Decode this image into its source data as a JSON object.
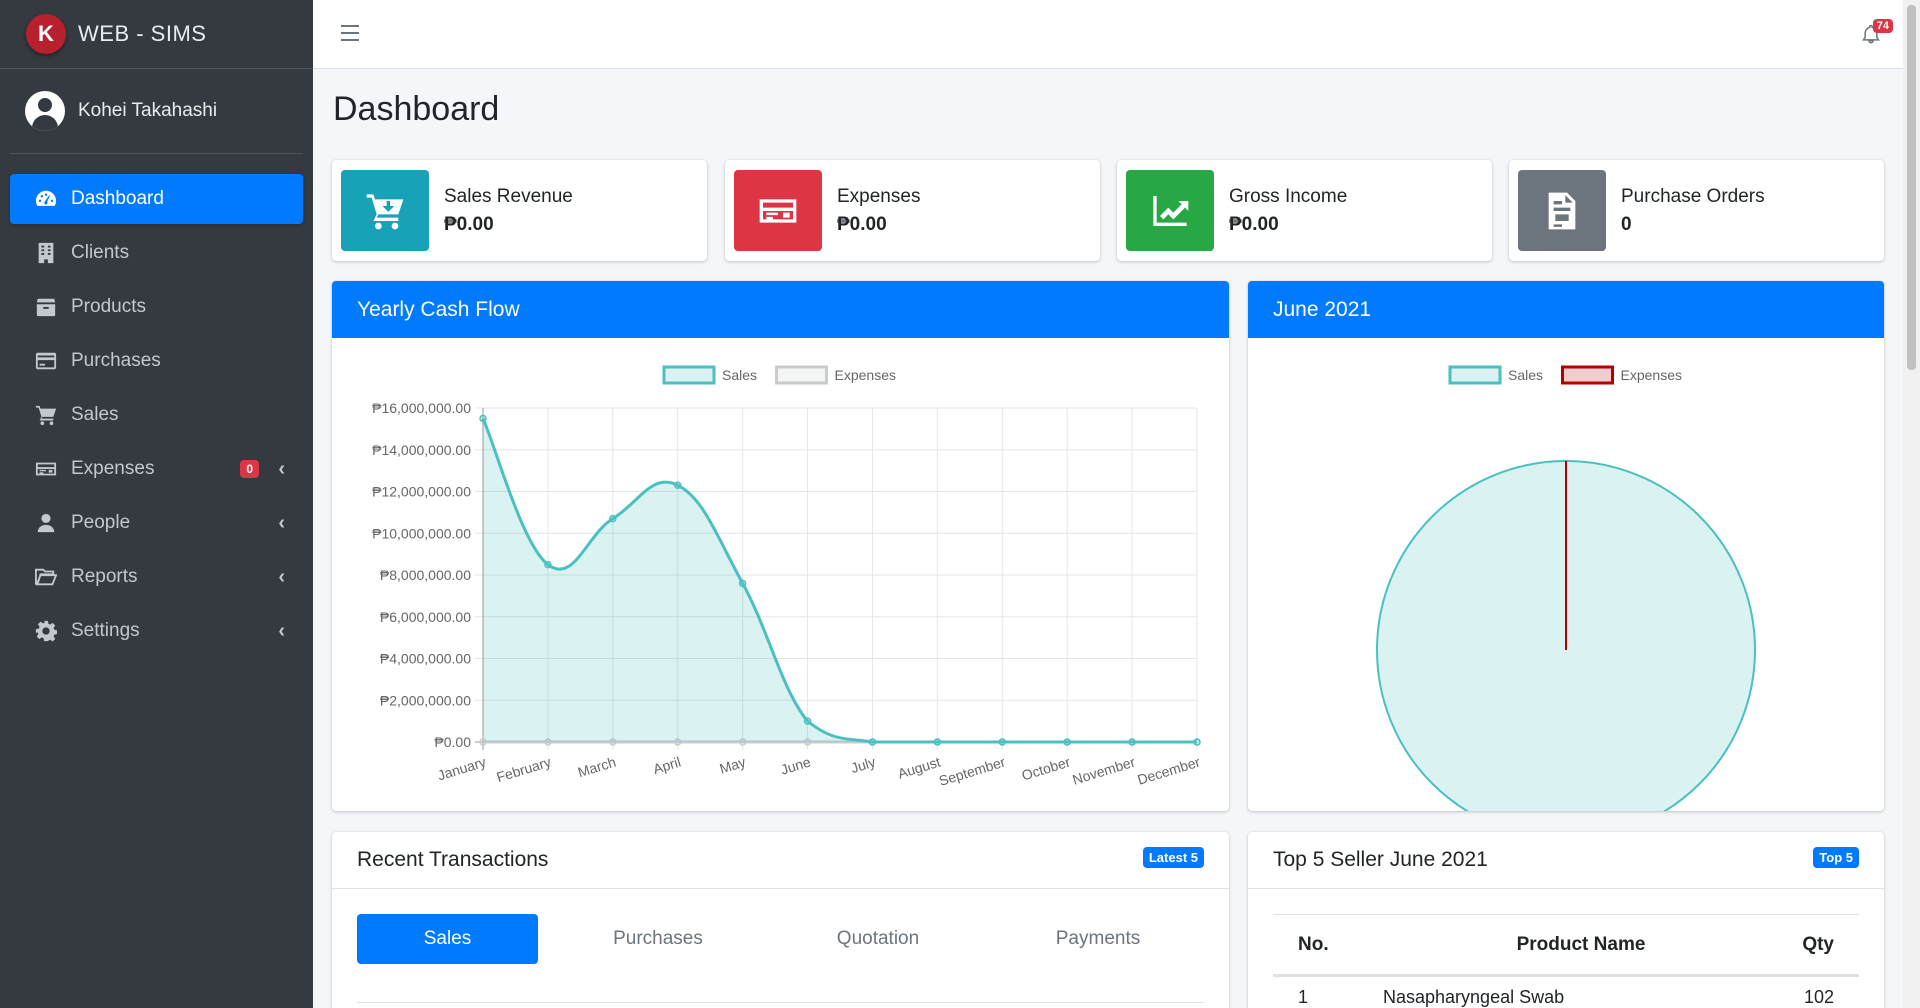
{
  "app": {
    "brand_letter": "K",
    "brand_name": "WEB - SIMS",
    "user_name": "Kohei Takahashi"
  },
  "sidebar": {
    "items": [
      {
        "label": "Dashboard",
        "icon": "tachometer-icon",
        "active": true
      },
      {
        "label": "Clients",
        "icon": "building-icon"
      },
      {
        "label": "Products",
        "icon": "box-icon"
      },
      {
        "label": "Purchases",
        "icon": "credit-card-icon"
      },
      {
        "label": "Sales",
        "icon": "cart-icon"
      },
      {
        "label": "Expenses",
        "icon": "money-check-icon",
        "badge": "0",
        "chevron": true
      },
      {
        "label": "People",
        "icon": "user-icon",
        "chevron": true
      },
      {
        "label": "Reports",
        "icon": "folder-open-icon",
        "chevron": true
      },
      {
        "label": "Settings",
        "icon": "gear-icon",
        "chevron": true
      }
    ]
  },
  "topbar": {
    "notification_count": "74"
  },
  "page": {
    "title": "Dashboard"
  },
  "info_boxes": [
    {
      "label": "Sales Revenue",
      "value": "₱0.00",
      "color": "#17a2b8",
      "icon": "cart-download-icon"
    },
    {
      "label": "Expenses",
      "value": "₱0.00",
      "color": "#dc3545",
      "icon": "money-check-icon"
    },
    {
      "label": "Gross Income",
      "value": "₱0.00",
      "color": "#28a745",
      "icon": "chart-line-icon"
    },
    {
      "label": "Purchase Orders",
      "value": "0",
      "color": "#6c757d",
      "icon": "file-invoice-icon"
    }
  ],
  "cash_flow_card": {
    "title": "Yearly Cash Flow"
  },
  "month_card": {
    "title": "June 2021"
  },
  "recent_transactions": {
    "title": "Recent Transactions",
    "tag": "Latest 5",
    "tabs": [
      "Sales",
      "Purchases",
      "Quotation",
      "Payments"
    ]
  },
  "top_seller": {
    "title": "Top 5 Seller June 2021",
    "tag": "Top 5",
    "headers": {
      "no": "No.",
      "name": "Product Name",
      "qty": "Qty"
    },
    "rows": [
      {
        "no": "1",
        "name": "Nasapharyngeal Swab",
        "qty": "102"
      }
    ]
  },
  "chart_data": [
    {
      "type": "line",
      "legend": [
        "Sales",
        "Expenses"
      ],
      "categories": [
        "January",
        "February",
        "March",
        "April",
        "May",
        "June",
        "July",
        "August",
        "September",
        "October",
        "November",
        "December"
      ],
      "series": [
        {
          "name": "Sales",
          "values": [
            15500000,
            8500000,
            10700000,
            12300000,
            7600000,
            1000000,
            0,
            0,
            0,
            0,
            0,
            0
          ],
          "color": "#4bc0c0"
        },
        {
          "name": "Expenses",
          "values": [
            0,
            0,
            0,
            0,
            0,
            0,
            0,
            0,
            0,
            0,
            0,
            0
          ],
          "color": "#c9cbcf"
        }
      ],
      "yticks": [
        "₱16,000,000.00",
        "₱14,000,000.00",
        "₱12,000,000.00",
        "₱10,000,000.00",
        "₱8,000,000.00",
        "₱6,000,000.00",
        "₱4,000,000.00",
        "₱2,000,000.00",
        "₱0.00"
      ],
      "ylim": [
        0,
        16000000
      ],
      "grid": true,
      "legend_position": "top"
    },
    {
      "type": "pie",
      "legend": [
        "Sales",
        "Expenses"
      ],
      "labels": [
        "Sales",
        "Expenses"
      ],
      "values": [
        100,
        0
      ],
      "colors": [
        "#4bc0c0",
        "#b30000"
      ],
      "legend_position": "top"
    }
  ]
}
